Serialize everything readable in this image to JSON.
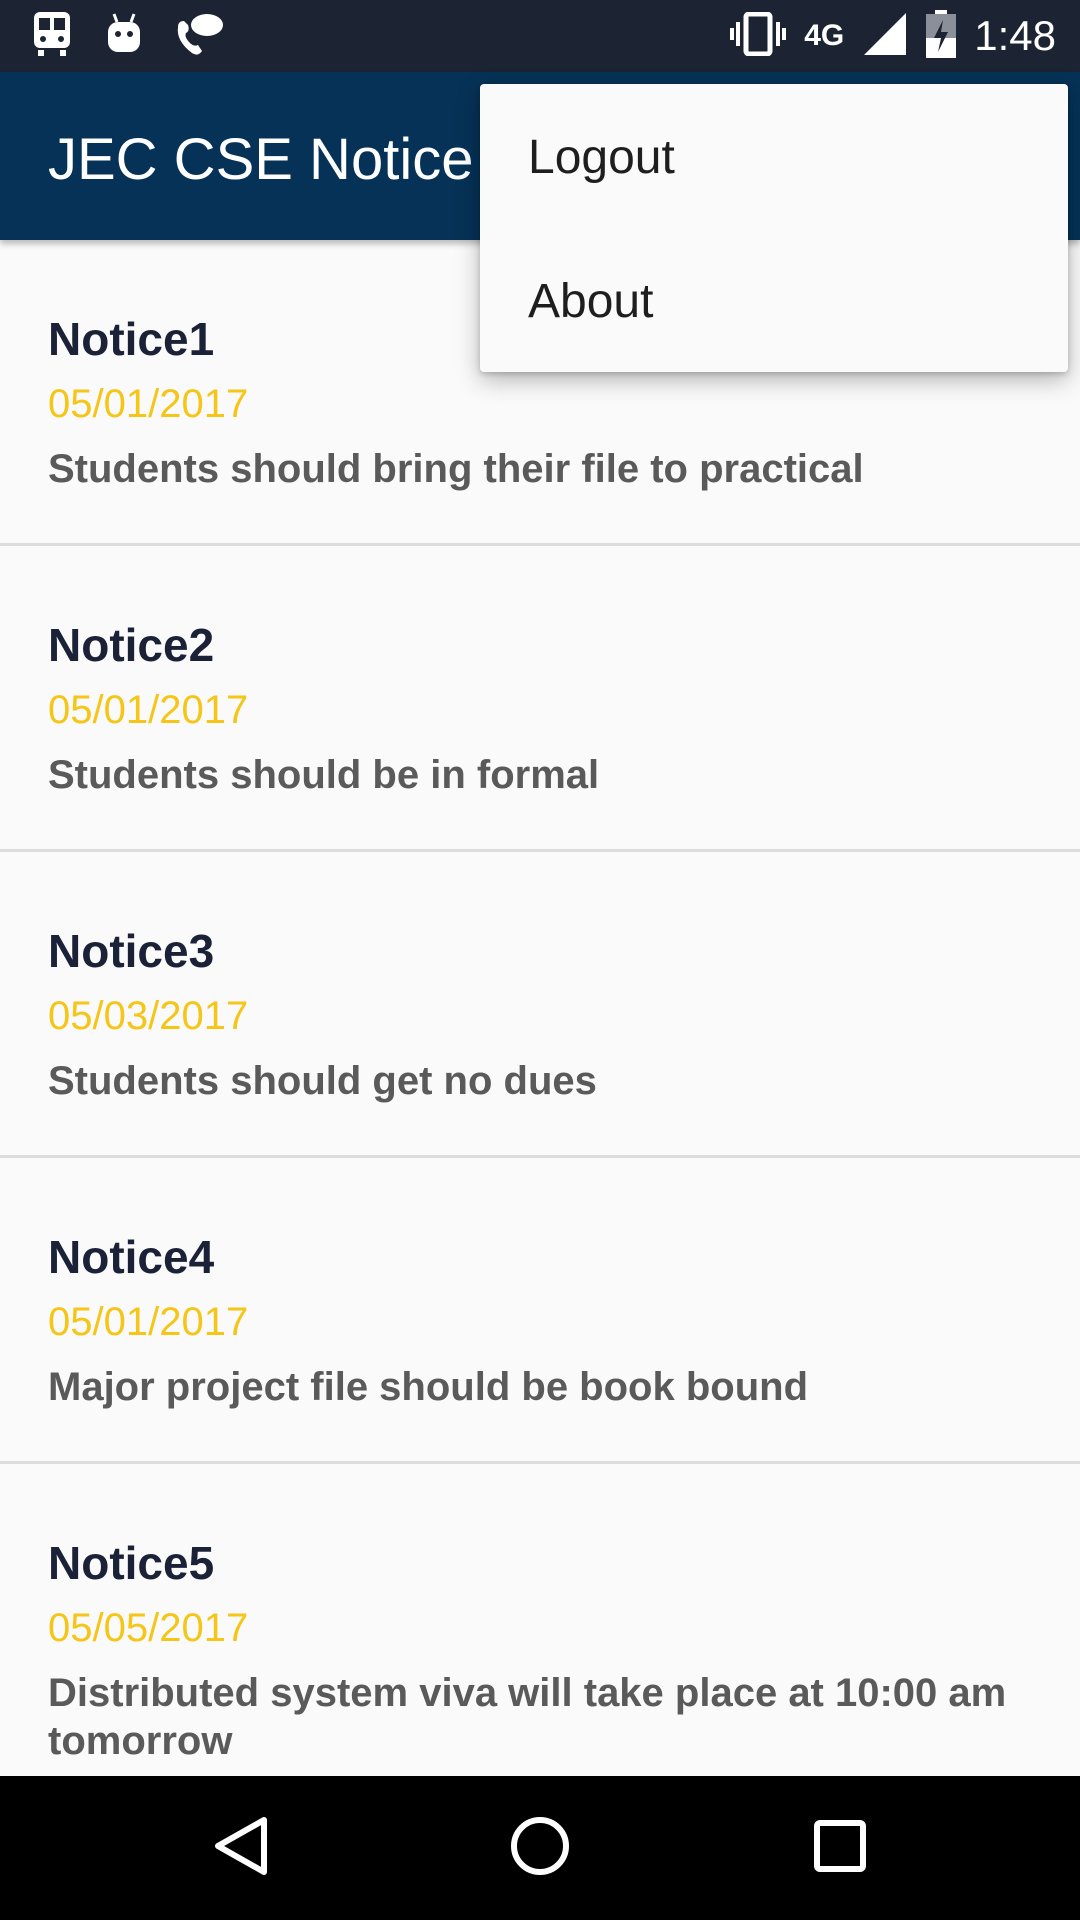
{
  "status_bar": {
    "icons_left": [
      "train-icon",
      "android-icon",
      "phone-chat-icon"
    ],
    "icons_right": [
      "vibrate-icon",
      "signal-icon",
      "battery-charging-icon"
    ],
    "network": "4G",
    "time": "1:48"
  },
  "app_bar": {
    "title": "JEC CSE Notice"
  },
  "menu": {
    "items": [
      {
        "label": "Logout"
      },
      {
        "label": "About"
      }
    ]
  },
  "notices": [
    {
      "title": "Notice1",
      "date": "05/01/2017",
      "description": "Students should bring their file to practical"
    },
    {
      "title": "Notice2",
      "date": "05/01/2017",
      "description": "Students should be in formal"
    },
    {
      "title": "Notice3",
      "date": "05/03/2017",
      "description": "Students should get no dues"
    },
    {
      "title": "Notice4",
      "date": "05/01/2017",
      "description": "Major project file should be book bound"
    },
    {
      "title": "Notice5",
      "date": "05/05/2017",
      "description": "Distributed system viva will take place at 10:00 am tomorrow"
    }
  ],
  "nav_bar": {
    "icons": [
      "back-icon",
      "home-icon",
      "recents-icon"
    ]
  },
  "colors": {
    "app_bar": "#063257",
    "status_bar": "#1c2433",
    "date_accent": "#f5c518",
    "title_text": "#1b2237",
    "description_text": "#5a5a5a"
  }
}
